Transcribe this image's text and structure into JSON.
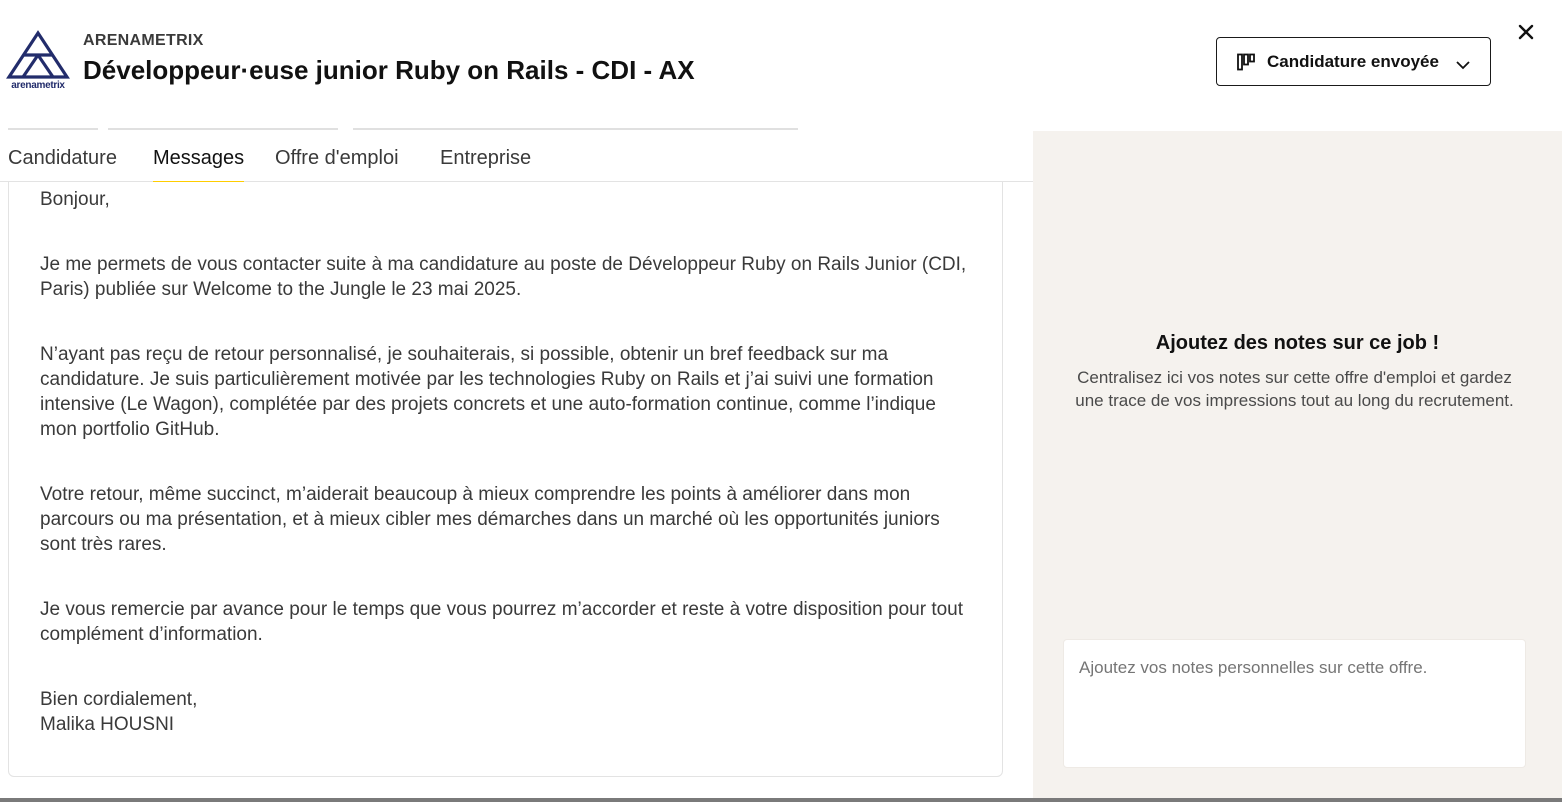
{
  "header": {
    "logo_text": "arenametrix",
    "company": "ARENAMETRIX",
    "job_title": "Développeur·euse junior Ruby on Rails - CDI - AX",
    "status_label": "Candidature envoyée",
    "icons": {
      "status": "kanban-icon",
      "dropdown": "chevron-down-icon",
      "close": "close-icon"
    }
  },
  "tabs": [
    {
      "label": "Candidature",
      "active": false
    },
    {
      "label": "Messages",
      "active": true
    },
    {
      "label": "Offre d'emploi",
      "active": false
    },
    {
      "label": "Entreprise",
      "active": false
    }
  ],
  "message": {
    "paragraphs": [
      "Bonjour,",
      "Je me permets de vous contacter suite à ma candidature au poste de Développeur Ruby on Rails Junior (CDI, Paris) publiée sur Welcome to the Jungle le 23 mai 2025.",
      "N’ayant pas reçu de retour personnalisé, je souhaiterais, si possible, obtenir un bref feedback sur ma candidature. Je suis particulièrement motivée par les technologies Ruby on Rails et j’ai suivi une formation intensive (Le Wagon), complétée par des projets concrets et une auto-formation continue, comme l’indique mon portfolio GitHub.",
      "Votre retour, même succinct, m’aiderait beaucoup à mieux comprendre les points à améliorer dans mon parcours ou ma présentation, et à mieux cibler mes démarches dans un marché où les opportunités juniors sont très rares.",
      "Je vous remercie par avance pour le temps que vous pourrez m’accorder et reste à votre disposition pour tout complément d’information.",
      "Bien cordialement,",
      "Malika HOUSNI"
    ]
  },
  "notes": {
    "title": "Ajoutez des notes sur ce job !",
    "description": "Centralisez ici vos notes sur cette offre d'emploi et gardez une trace de vos impressions tout au long du recrutement.",
    "placeholder": "Ajoutez vos notes personnelles sur cette offre."
  },
  "colors": {
    "accent": "#ffcd00",
    "logo": "#222c6b",
    "panel_bg": "#f5f2ee"
  }
}
